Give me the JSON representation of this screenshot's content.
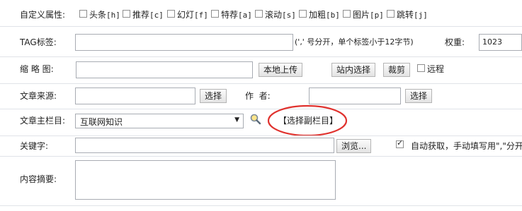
{
  "custom_attrs": {
    "label": "自定义属性:",
    "items": [
      {
        "name": "头条",
        "code": "[h]",
        "checked": false
      },
      {
        "name": "推荐",
        "code": "[c]",
        "checked": false
      },
      {
        "name": "幻灯",
        "code": "[f]",
        "checked": false
      },
      {
        "name": "特荐",
        "code": "[a]",
        "checked": false
      },
      {
        "name": "滚动",
        "code": "[s]",
        "checked": false
      },
      {
        "name": "加粗",
        "code": "[b]",
        "checked": false
      },
      {
        "name": "图片",
        "code": "[p]",
        "checked": false
      },
      {
        "name": "跳转",
        "code": "[j]",
        "checked": false
      }
    ]
  },
  "tag": {
    "label": "TAG标签:",
    "value": "",
    "hint": "(',' 号分开，单个标签小于12字节)",
    "weight_label": "权重:",
    "weight_value": "1023"
  },
  "thumbnail": {
    "label": "缩 略 图:",
    "value": "",
    "upload_button": "本地上传",
    "site_select_button": "站内选择",
    "crop_button": "裁剪",
    "remote_label": "远程",
    "remote_checked": false
  },
  "source": {
    "label": "文章来源:",
    "value": "",
    "select_button": "选择",
    "author_label": "作  者:",
    "author_value": "",
    "author_select_button": "选择"
  },
  "category": {
    "label": "文章主栏目:",
    "selected": "互联网知识",
    "sub_category_link": "【选择副栏目】",
    "highlight_color": "#e0322e"
  },
  "keywords": {
    "label": "关键字:",
    "value": "",
    "browse_button": "浏览...",
    "auto_checked": true,
    "auto_label": "自动获取，手动填写用\",\"分开"
  },
  "summary": {
    "label": "内容摘要:",
    "value": ""
  }
}
